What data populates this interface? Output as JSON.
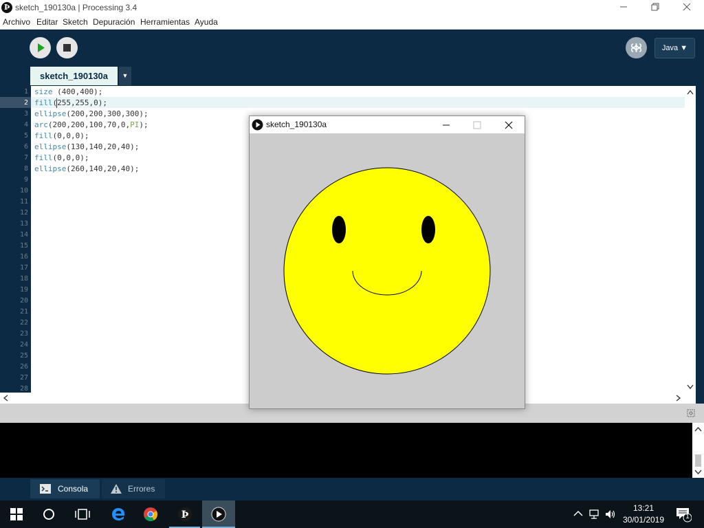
{
  "window": {
    "title": "sketch_190130a | Processing 3.4",
    "app_icon": "Þ"
  },
  "menu": [
    "Archivo",
    "Editar",
    "Sketch",
    "Depuración",
    "Herramientas",
    "Ayuda"
  ],
  "toolbar": {
    "mode": "Java ▼"
  },
  "tab": {
    "label": "sketch_190130a",
    "arrow": "▼"
  },
  "editor": {
    "line_numbers": [
      "1",
      "2",
      "3",
      "4",
      "5",
      "6",
      "7",
      "8",
      "9",
      "10",
      "11",
      "12",
      "13",
      "14",
      "15",
      "16",
      "17",
      "18",
      "19",
      "20",
      "21",
      "22",
      "23",
      "24",
      "25",
      "26",
      "27",
      "28"
    ],
    "current_line": 2,
    "code": [
      {
        "fn": "size",
        "args": " (400,400);"
      },
      {
        "fn": "fill",
        "args": "(255,255,0);"
      },
      {
        "fn": "ellipse",
        "args": "(200,200,300,300);"
      },
      {
        "fn": "arc",
        "args": "(200,200,100,70,0,",
        "const": "PI",
        "tail": ");"
      },
      {
        "fn": "fill",
        "args": "(0,0,0);"
      },
      {
        "fn": "ellipse",
        "args": "(130,140,20,40);"
      },
      {
        "fn": "fill",
        "args": "(0,0,0);"
      },
      {
        "fn": "ellipse",
        "args": "(260,140,20,40);"
      }
    ]
  },
  "sketch_window": {
    "title": "sketch_190130a",
    "face_color": "#ffff00",
    "bg_color": "#cccccc"
  },
  "bottom_tabs": {
    "console": "Consola",
    "errors": "Errores"
  },
  "taskbar": {
    "time": "13:21",
    "date": "30/01/2019",
    "notification_count": "1"
  },
  "colors": {
    "ide_bg": "#0c2a43",
    "tab_bg": "#e6f5f2",
    "line_highlight": "#e8f4f5",
    "keyword": "#3a8aad",
    "run_green": "#1aa51a"
  }
}
